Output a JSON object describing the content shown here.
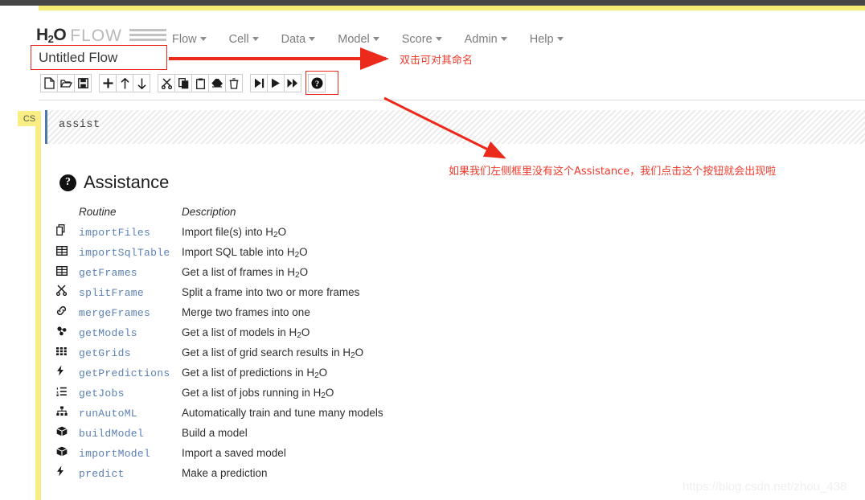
{
  "colors": {
    "topbar_dark": "#464646",
    "topbar_yellow": "#f7ec75",
    "cell_badge_yellow": "#f9ee84",
    "annotation_red": "#f0392b",
    "highlight_border": "#e8291c",
    "routine_link": "#5a7fb5",
    "cell_active_border": "#5078a6"
  },
  "header": {
    "brand_h2o": "H",
    "brand_sub": "2",
    "brand_o": "O",
    "brand_flow": "FLOW",
    "brand_bars_icon": "hamburger-bars-icon",
    "menu": [
      {
        "label": "Flow"
      },
      {
        "label": "Cell"
      },
      {
        "label": "Data"
      },
      {
        "label": "Model"
      },
      {
        "label": "Score"
      },
      {
        "label": "Admin"
      },
      {
        "label": "Help"
      }
    ]
  },
  "flow": {
    "name_value": "Untitled Flow",
    "name_placeholder": "Untitled Flow"
  },
  "toolbar": {
    "groups": [
      {
        "buttons": [
          {
            "name": "new-flow-button",
            "icon": "file-icon",
            "title": "New"
          },
          {
            "name": "open-flow-button",
            "icon": "folder-open-icon",
            "title": "Open"
          },
          {
            "name": "save-flow-button",
            "icon": "save-disk-icon",
            "title": "Save"
          }
        ]
      },
      {
        "buttons": [
          {
            "name": "insert-cell-button",
            "icon": "plus-icon",
            "title": "Insert Cell"
          },
          {
            "name": "move-cell-up-button",
            "icon": "arrow-up-icon",
            "title": "Move Cell Up"
          },
          {
            "name": "move-cell-down-button",
            "icon": "arrow-down-icon",
            "title": "Move Cell Down"
          }
        ]
      },
      {
        "buttons": [
          {
            "name": "cut-cell-button",
            "icon": "scissors-icon",
            "title": "Cut Cell"
          },
          {
            "name": "copy-cell-button",
            "icon": "copy-icon",
            "title": "Copy Cell"
          },
          {
            "name": "paste-cell-button",
            "icon": "clipboard-icon",
            "title": "Paste Cell"
          },
          {
            "name": "clear-cell-button",
            "icon": "eraser-icon",
            "title": "Clear Cell"
          },
          {
            "name": "delete-cell-button",
            "icon": "trash-icon",
            "title": "Delete Cell"
          }
        ]
      },
      {
        "buttons": [
          {
            "name": "run-and-select-below-button",
            "icon": "step-forward-icon",
            "title": "Run and Select Below"
          },
          {
            "name": "run-cell-button",
            "icon": "play-icon",
            "title": "Run Cell"
          },
          {
            "name": "run-all-cells-button",
            "icon": "fast-forward-icon",
            "title": "Run All Cells"
          }
        ]
      },
      {
        "buttons": [
          {
            "name": "assist-me-button",
            "icon": "question-circle-icon",
            "title": "Assist Me"
          }
        ]
      }
    ]
  },
  "cell": {
    "badge": "CS",
    "input_text": "assist"
  },
  "assistance": {
    "icon": "question-circle-icon",
    "title": "Assistance",
    "columns": {
      "routine": "Routine",
      "description": "Description"
    },
    "rows": [
      {
        "icon": "copy-files-icon",
        "routine": "importFiles",
        "desc_pre": "Import file(s) into H",
        "desc_sub": "2",
        "desc_post": "O"
      },
      {
        "icon": "table-icon",
        "routine": "importSqlTable",
        "desc_pre": "Import SQL table into H",
        "desc_sub": "2",
        "desc_post": "O"
      },
      {
        "icon": "table-icon",
        "routine": "getFrames",
        "desc_pre": "Get a list of frames in H",
        "desc_sub": "2",
        "desc_post": "O"
      },
      {
        "icon": "scissors-icon",
        "routine": "splitFrame",
        "desc_pre": "Split a frame into two or more frames",
        "desc_sub": "",
        "desc_post": ""
      },
      {
        "icon": "link-icon",
        "routine": "mergeFrames",
        "desc_pre": "Merge two frames into one",
        "desc_sub": "",
        "desc_post": ""
      },
      {
        "icon": "molecule-icon",
        "routine": "getModels",
        "desc_pre": "Get a list of models in H",
        "desc_sub": "2",
        "desc_post": "O"
      },
      {
        "icon": "grid-icon",
        "routine": "getGrids",
        "desc_pre": "Get a list of grid search results in H",
        "desc_sub": "2",
        "desc_post": "O"
      },
      {
        "icon": "lightning-icon",
        "routine": "getPredictions",
        "desc_pre": "Get a list of predictions in H",
        "desc_sub": "2",
        "desc_post": "O"
      },
      {
        "icon": "ordered-list-icon",
        "routine": "getJobs",
        "desc_pre": "Get a list of jobs running in H",
        "desc_sub": "2",
        "desc_post": "O"
      },
      {
        "icon": "sitemap-icon",
        "routine": "runAutoML",
        "desc_pre": "Automatically train and tune many models",
        "desc_sub": "",
        "desc_post": ""
      },
      {
        "icon": "cube-icon",
        "routine": "buildModel",
        "desc_pre": "Build a model",
        "desc_sub": "",
        "desc_post": ""
      },
      {
        "icon": "cube-icon",
        "routine": "importModel",
        "desc_pre": "Import a saved model",
        "desc_sub": "",
        "desc_post": ""
      },
      {
        "icon": "lightning-icon",
        "routine": "predict",
        "desc_pre": "Make a prediction",
        "desc_sub": "",
        "desc_post": ""
      }
    ]
  },
  "annotations": {
    "note_flow_name": "双击可对其命名",
    "note_assist_button": "如果我们左侧框里没有这个Assistance，我们点击这个按钮就会出现啦"
  },
  "watermark": {
    "text": "https://blog.csdn.net/zhou_438"
  }
}
